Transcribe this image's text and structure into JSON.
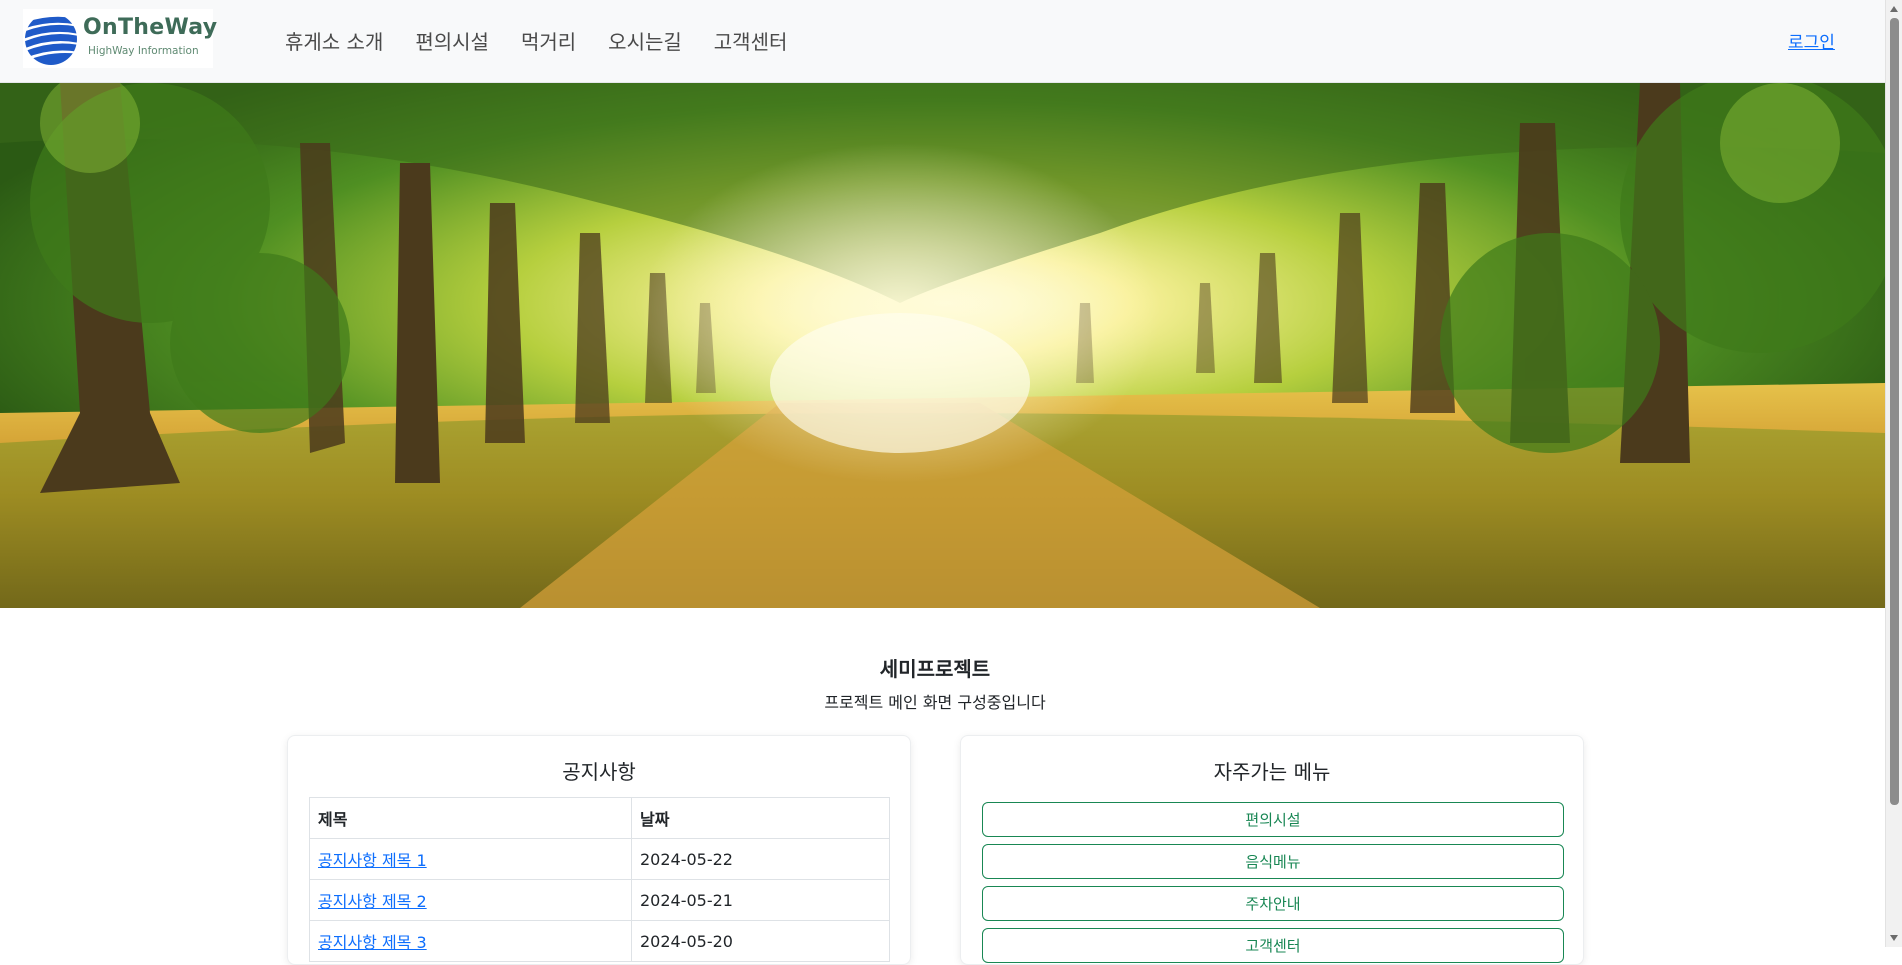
{
  "header": {
    "logo": {
      "title": "OnTheWay",
      "subtitle": "HighWay Information"
    },
    "nav": [
      {
        "label": "휴게소 소개"
      },
      {
        "label": "편의시설"
      },
      {
        "label": "먹거리"
      },
      {
        "label": "오시는길"
      },
      {
        "label": "고객센터"
      }
    ],
    "login_label": "로그인"
  },
  "intro": {
    "title": "세미프로젝트",
    "subtitle": "프로젝트 메인 화면 구성중입니다"
  },
  "notice": {
    "title": "공지사항",
    "columns": [
      "제목",
      "날짜"
    ],
    "rows": [
      {
        "title": "공지사항 제목 1",
        "date": "2024-05-22"
      },
      {
        "title": "공지사항 제목 2",
        "date": "2024-05-21"
      },
      {
        "title": "공지사항 제목 3",
        "date": "2024-05-20"
      }
    ]
  },
  "quick_menu": {
    "title": "자주가는 메뉴",
    "buttons": [
      {
        "label": "편의시설"
      },
      {
        "label": "음식메뉴"
      },
      {
        "label": "주차안내"
      },
      {
        "label": "고객센터"
      }
    ]
  },
  "colors": {
    "link": "#0d6efd",
    "quick_button": "#198754",
    "header_bg": "#f8f9fa",
    "logo_text": "#3e6b58"
  }
}
